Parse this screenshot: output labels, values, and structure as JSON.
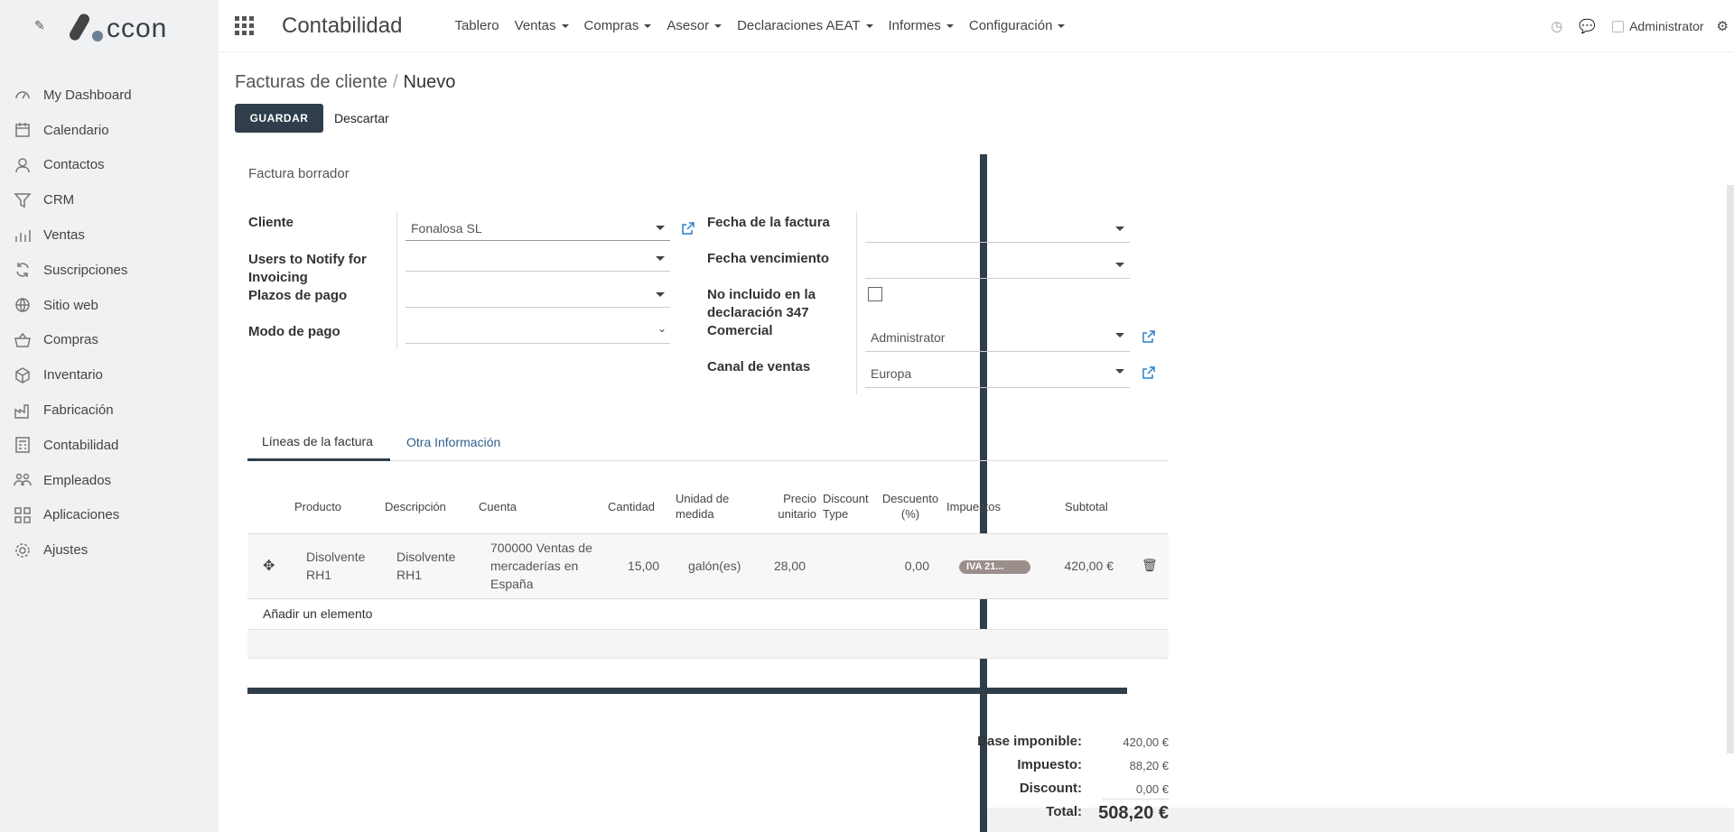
{
  "sidebar": {
    "logo_text": "ccon",
    "items": [
      {
        "label": "My Dashboard",
        "icon": "dashboard-icon"
      },
      {
        "label": "Calendario",
        "icon": "calendar-icon"
      },
      {
        "label": "Contactos",
        "icon": "contacts-icon"
      },
      {
        "label": "CRM",
        "icon": "crm-filter-icon"
      },
      {
        "label": "Ventas",
        "icon": "sales-chart-icon"
      },
      {
        "label": "Suscripciones",
        "icon": "refresh-icon"
      },
      {
        "label": "Sitio web",
        "icon": "globe-icon"
      },
      {
        "label": "Compras",
        "icon": "basket-icon"
      },
      {
        "label": "Inventario",
        "icon": "box-icon"
      },
      {
        "label": "Fabricación",
        "icon": "factory-icon"
      },
      {
        "label": "Contabilidad",
        "icon": "accounting-icon"
      },
      {
        "label": "Empleados",
        "icon": "employees-icon"
      },
      {
        "label": "Aplicaciones",
        "icon": "apps-grid-icon"
      },
      {
        "label": "Ajustes",
        "icon": "gear-icon"
      }
    ]
  },
  "topbar": {
    "app_title": "Contabilidad",
    "menu": [
      "Tablero",
      "Ventas",
      "Compras",
      "Asesor",
      "Declaraciones AEAT",
      "Informes",
      "Configuración"
    ],
    "user": "Administrator"
  },
  "control_panel": {
    "breadcrumb_parent": "Facturas de cliente",
    "breadcrumb_sep": "/",
    "breadcrumb_current": "Nuevo",
    "save_label": "GUARDAR",
    "discard_label": "Descartar"
  },
  "form": {
    "status": "Factura borrador",
    "left": {
      "cliente_label": "Cliente",
      "cliente_value": "Fonalosa SL",
      "notify_label": "Users to Notify for Invoicing",
      "plazos_label": "Plazos de pago",
      "modo_label": "Modo de pago"
    },
    "right": {
      "fecha_label": "Fecha de la factura",
      "vencimiento_label": "Fecha vencimiento",
      "no347_label": "No incluido en la declaración 347",
      "comercial_label": "Comercial",
      "comercial_value": "Administrator",
      "canal_label": "Canal de ventas",
      "canal_value": "Europa"
    },
    "tabs": [
      "Líneas de la factura",
      "Otra Información"
    ],
    "lines": {
      "headers": {
        "producto": "Producto",
        "descripcion": "Descripción",
        "cuenta": "Cuenta",
        "cantidad": "Cantidad",
        "unidad": "Unidad de medida",
        "precio": "Precio unitario",
        "discount_type": "Discount Type",
        "descuento": "Descuento (%)",
        "impuestos": "Impuestos",
        "subtotal": "Subtotal"
      },
      "rows": [
        {
          "producto": "Disolvente RH1",
          "descripcion": "Disolvente RH1",
          "cuenta": "700000 Ventas de mercaderías en España",
          "cantidad": "15,00",
          "unidad": "galón(es)",
          "precio": "28,00",
          "descuento": "0,00",
          "impuesto": "IVA 21...",
          "subtotal": "420,00 €"
        }
      ],
      "add_label": "Añadir un elemento"
    },
    "totals": {
      "base_label": "Base imponible:",
      "base_value": "420,00 €",
      "impuesto_label": "Impuesto:",
      "impuesto_value": "88,20 €",
      "discount_label": "Discount:",
      "discount_value": "0,00 €",
      "total_label": "Total:",
      "total_value": "508,20 €"
    }
  },
  "colors": {
    "primary_dark": "#2f3e4a",
    "link_blue": "#2a7fc9",
    "sidebar_bg": "#f0f1f3"
  }
}
